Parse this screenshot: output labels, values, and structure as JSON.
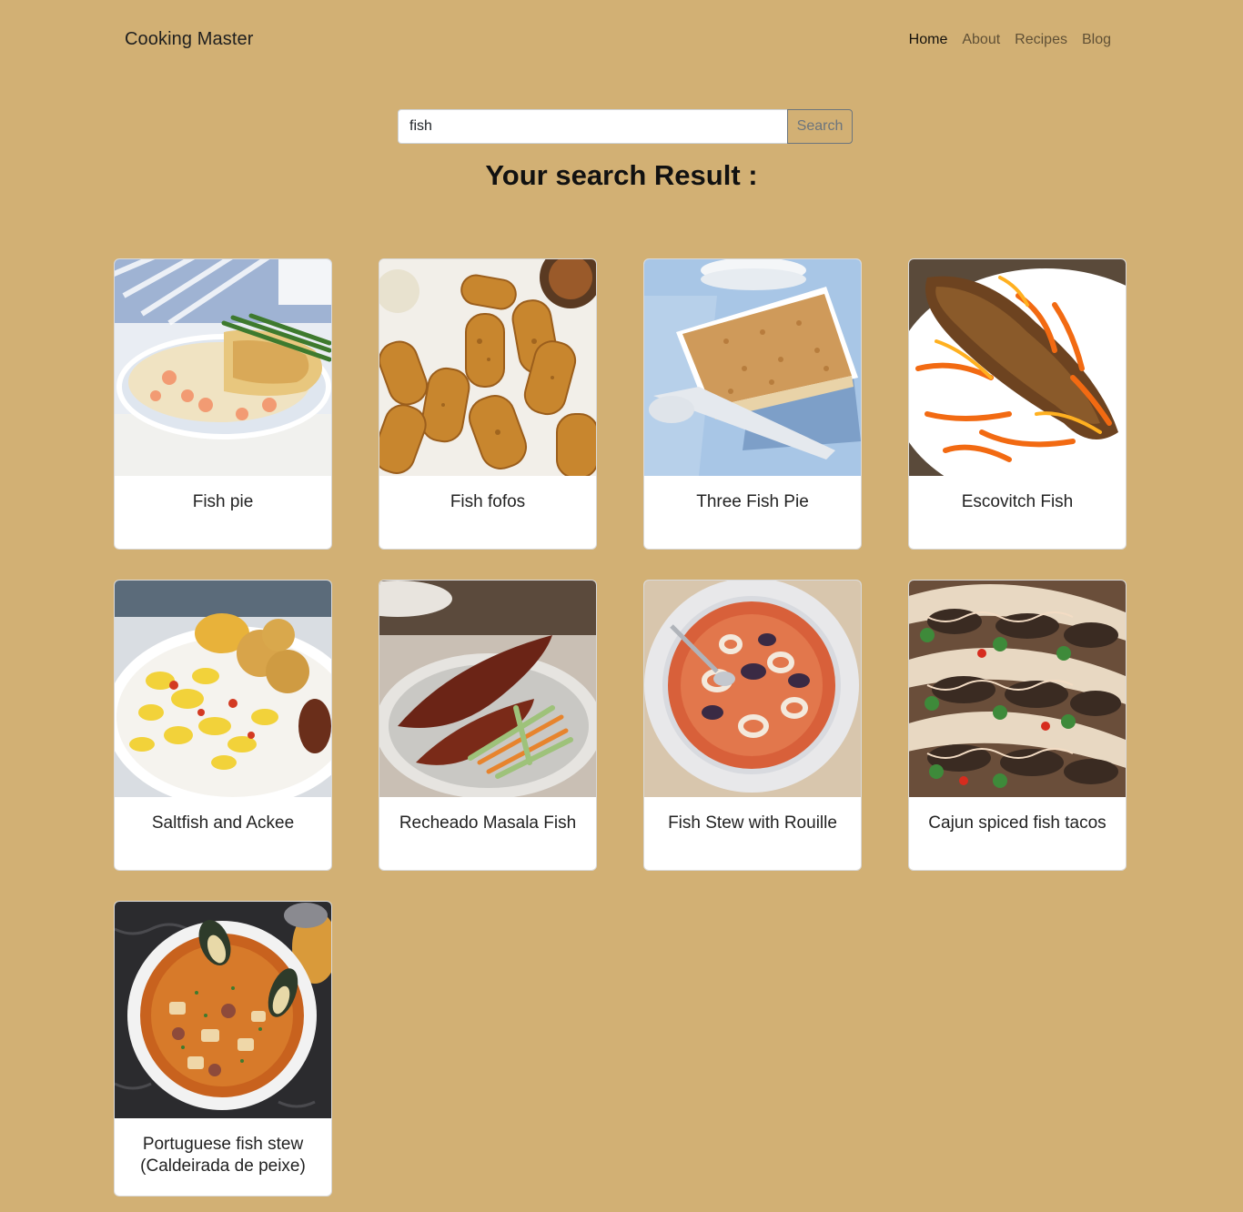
{
  "navbar": {
    "brand": "Cooking Master",
    "links": [
      {
        "label": "Home",
        "active": true
      },
      {
        "label": "About",
        "active": false
      },
      {
        "label": "Recipes",
        "active": false
      },
      {
        "label": "Blog",
        "active": false
      }
    ]
  },
  "search": {
    "value": "fish",
    "button_label": "Search"
  },
  "results": {
    "heading": "Your search Result :",
    "items": [
      {
        "title": "Fish pie",
        "image": "fish-pie-photo"
      },
      {
        "title": "Fish fofos",
        "image": "fish-fofos-photo"
      },
      {
        "title": "Three Fish Pie",
        "image": "three-fish-pie-photo"
      },
      {
        "title": "Escovitch Fish",
        "image": "escovitch-fish-photo"
      },
      {
        "title": "Saltfish and Ackee",
        "image": "saltfish-ackee-photo"
      },
      {
        "title": "Recheado Masala Fish",
        "image": "recheado-masala-fish-photo"
      },
      {
        "title": "Fish Stew with Rouille",
        "image": "fish-stew-rouille-photo"
      },
      {
        "title": "Cajun spiced fish tacos",
        "image": "cajun-fish-tacos-photo"
      },
      {
        "title": "Portuguese fish stew (Caldeirada de peixe)",
        "image": "portuguese-fish-stew-photo"
      }
    ]
  },
  "colors": {
    "page_background": "#d2b074",
    "card_background": "#ffffff",
    "search_button_border": "#6c757d"
  }
}
